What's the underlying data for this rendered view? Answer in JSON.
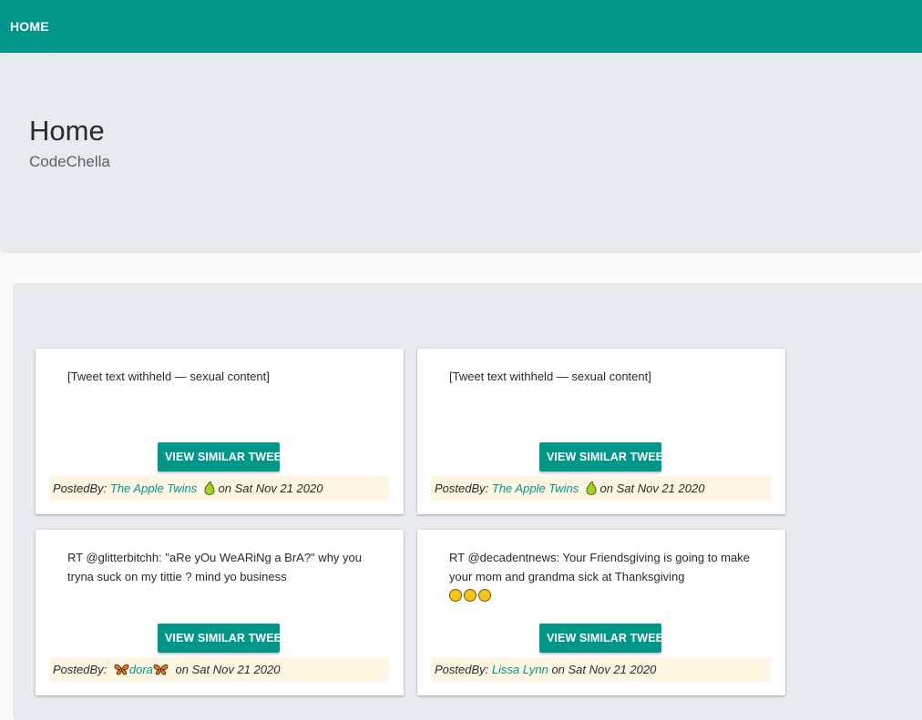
{
  "navbar": {
    "home_label": "HOME"
  },
  "header": {
    "title": "Home",
    "subtitle": "CodeChella"
  },
  "colors": {
    "accent": "#009688",
    "posted_bg": "#fdf6e3",
    "panel_bg": "#e8ebee"
  },
  "cards": [
    {
      "text": "[Tweet text withheld — sexual content]",
      "button_label": "VIEW SIMILAR TWEETS",
      "posted_by_label": "PostedBy:",
      "author": "The Apple Twins",
      "author_icon": "pear-icon",
      "date_text": "on Sat Nov 21 2020"
    },
    {
      "text": "[Tweet text withheld — sexual content]",
      "button_label": "VIEW SIMILAR TWEETS",
      "posted_by_label": "PostedBy:",
      "author": "The Apple Twins",
      "author_icon": "pear-icon",
      "date_text": "on Sat Nov 21 2020"
    },
    {
      "text": "RT @glitterbitchh: \"aRe yOu WeARiNg a BrA?\" why you tryna suck on my tittie ? mind yo business",
      "button_label": "VIEW SIMILAR TWEETS",
      "posted_by_label": "PostedBy:",
      "author": "dora",
      "author_icon": "butterfly-icon",
      "date_text": "on Sat Nov 21 2020"
    },
    {
      "text": "RT @decadentnews: Your Friendsgiving is going to make your mom and grandma sick at Thanksgiving",
      "text_emojis": [
        "grimacing-face-icon",
        "worried-face-icon",
        "surprised-face-icon"
      ],
      "button_label": "VIEW SIMILAR TWEETS",
      "posted_by_label": "PostedBy:",
      "author": "Lissa Lynn",
      "date_text": "on Sat Nov 21 2020"
    }
  ]
}
